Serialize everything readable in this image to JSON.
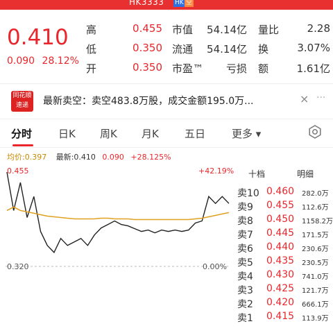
{
  "header": {
    "code": "HK3333",
    "badge_market": "HK",
    "badge_short": "空",
    "price": "0.410",
    "change": "0.090",
    "change_pct": "28.12%"
  },
  "stats": [
    {
      "label": "高",
      "value": "0.455",
      "label2": "市值",
      "value2": "54.14亿",
      "label3": "量比",
      "value3": "2.28"
    },
    {
      "label": "低",
      "value": "0.350",
      "label2": "流通",
      "value2": "54.14亿",
      "label3": "换",
      "value3": "3.07%"
    },
    {
      "label": "开",
      "value": "0.350",
      "label2": "市盈™",
      "value2": "亏损",
      "label3": "额",
      "value3": "1.61亿"
    }
  ],
  "news": {
    "logo_line1": "同花顺",
    "logo_line2": "速递",
    "text": "最新卖空：卖空483.8万股，成交金额195.0万...",
    "close": "×",
    "more": "···"
  },
  "tabs": [
    "分时",
    "日K",
    "周K",
    "月K",
    "五日",
    "更多 ▾"
  ],
  "info_line": {
    "avg": "均价:0.397",
    "latest": "最新:0.410",
    "change": "0.090",
    "pct": "+28.125%"
  },
  "chart": {
    "y_top": "0.455",
    "pct_top": "+42.19%",
    "y_bottom": "0.320",
    "pct_bottom": "0.00%"
  },
  "chart_data": {
    "type": "line",
    "title": "",
    "xlabel": "",
    "ylabel": "",
    "ylim": [
      0.32,
      0.455
    ],
    "series": [
      {
        "values": [
          0.455,
          0.4,
          0.44,
          0.39,
          0.42,
          0.37,
          0.35,
          0.34,
          0.36,
          0.35,
          0.355,
          0.36,
          0.35,
          0.365,
          0.375,
          0.38,
          0.385,
          0.38,
          0.378,
          0.374,
          0.37,
          0.372,
          0.368,
          0.372,
          0.37,
          0.372,
          0.37,
          0.372,
          0.382,
          0.385,
          0.42,
          0.41,
          0.42,
          0.41
        ]
      },
      {
        "values": [
          0.4,
          0.405,
          0.4,
          0.398,
          0.396,
          0.394,
          0.392,
          0.391,
          0.39,
          0.389,
          0.388,
          0.388,
          0.388,
          0.388,
          0.389,
          0.389,
          0.388,
          0.388,
          0.388,
          0.387,
          0.387,
          0.387,
          0.387,
          0.387,
          0.387,
          0.387,
          0.387,
          0.387,
          0.388,
          0.389,
          0.391,
          0.393,
          0.395,
          0.397
        ]
      }
    ]
  },
  "book": {
    "head_left": "十档",
    "head_right": "明细",
    "rows": [
      {
        "name": "卖10",
        "price": "0.460",
        "vol": "282.0万"
      },
      {
        "name": "卖9",
        "price": "0.455",
        "vol": "112.6万"
      },
      {
        "name": "卖8",
        "price": "0.450",
        "vol": "1158.2万"
      },
      {
        "name": "卖7",
        "price": "0.445",
        "vol": "171.5万"
      },
      {
        "name": "卖6",
        "price": "0.440",
        "vol": "230.6万"
      },
      {
        "name": "卖5",
        "price": "0.435",
        "vol": "230.5万"
      },
      {
        "name": "卖4",
        "price": "0.430",
        "vol": "741.0万"
      },
      {
        "name": "卖3",
        "price": "0.425",
        "vol": "121.7万"
      },
      {
        "name": "卖2",
        "price": "0.420",
        "vol": "666.1万"
      },
      {
        "name": "卖1",
        "price": "0.415",
        "vol": "113.9万"
      }
    ]
  },
  "colors": {
    "accent": "#e8262b",
    "price_line": "#222222",
    "avg_line": "#e0a020"
  }
}
